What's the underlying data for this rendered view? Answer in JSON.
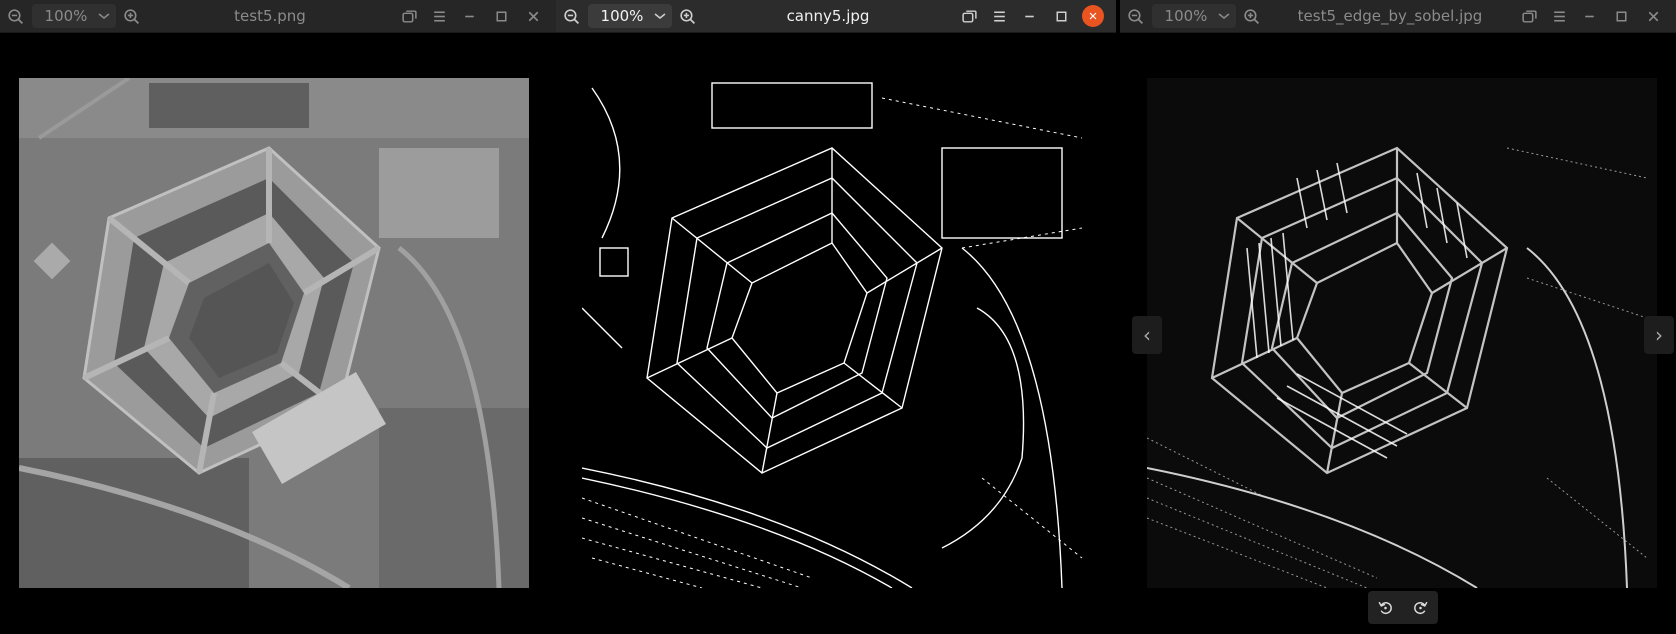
{
  "windows": [
    {
      "filename": "test5.png",
      "zoom": "100%",
      "active": false,
      "image": {
        "kind": "aerial-photo-grayscale"
      }
    },
    {
      "filename": "canny5.jpg",
      "zoom": "100%",
      "active": true,
      "image": {
        "kind": "canny-edge-map"
      }
    },
    {
      "filename": "test5_edge_by_sobel.jpg",
      "zoom": "100%",
      "active": false,
      "image": {
        "kind": "sobel-edge-map"
      },
      "nav": {
        "prev_glyph": "‹",
        "next_glyph": "›"
      }
    }
  ],
  "icons": {
    "zoom_out": "zoom-out-icon",
    "zoom_in": "zoom-in-icon",
    "dropdown": "chevron-down-icon",
    "fullscreen": "fullscreen-icon",
    "menu": "hamburger-menu-icon",
    "minimize": "minimize-icon",
    "maximize": "maximize-icon",
    "close": "close-icon",
    "rotate_left": "rotate-left-icon",
    "rotate_right": "rotate-right-icon"
  },
  "colors": {
    "titlebar": "#2c2c2c",
    "background": "#000000",
    "close_accent": "#e95420"
  }
}
